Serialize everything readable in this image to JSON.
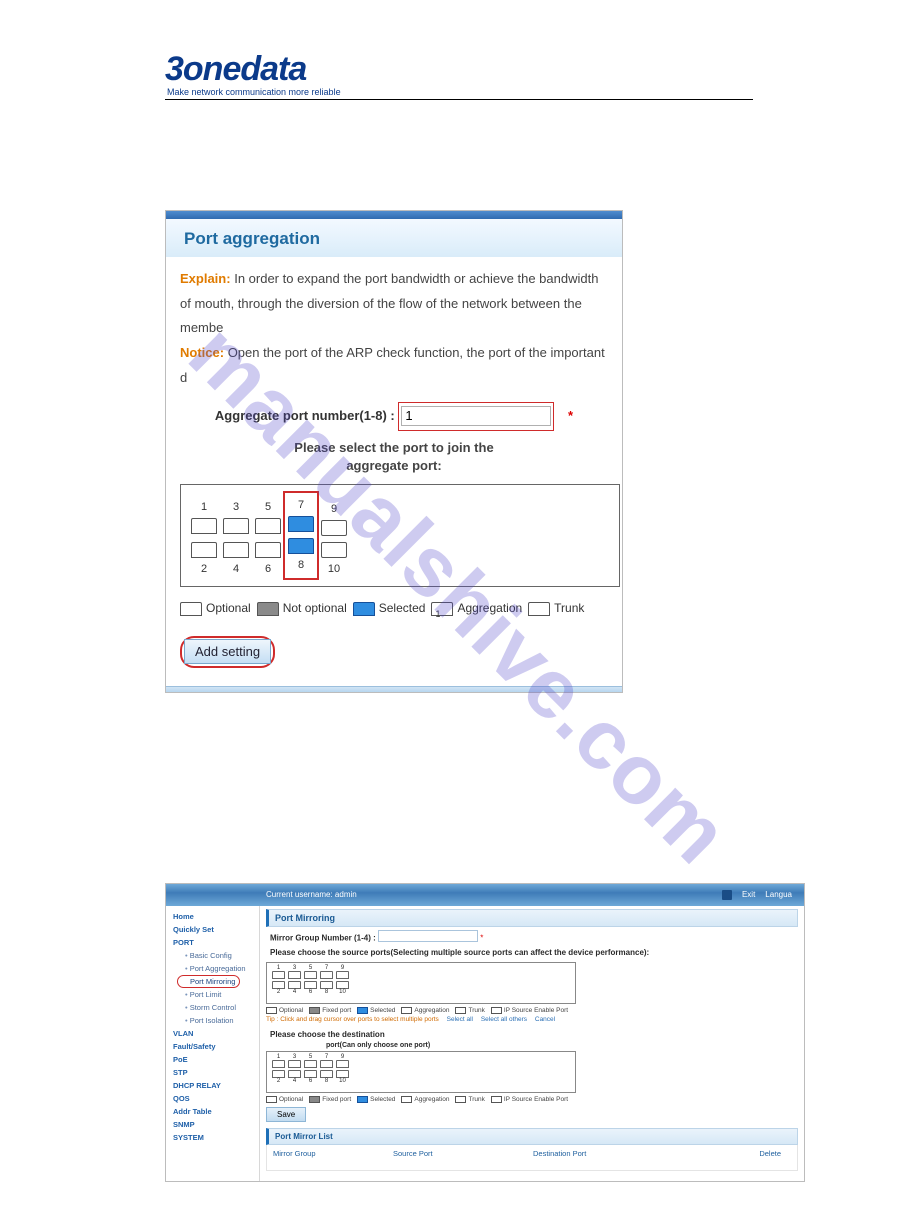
{
  "logo": {
    "brand": "3onedata",
    "tagline": "Make network communication more reliable"
  },
  "watermark": "manualshive.com",
  "shot1": {
    "title": "Port aggregation",
    "explain_label": "Explain:",
    "explain_text": "In order to expand the port bandwidth or achieve the bandwidth of mouth, through the diversion of the flow of the network between the membe",
    "notice_label": "Notice:",
    "notice_text": "Open the port of the ARP check function, the port of the important d",
    "agg_label": "Aggregate port number(1-8) :",
    "agg_value": "1",
    "asterisk": "*",
    "select_prompt_l1": "Please select the port to join the",
    "select_prompt_l2": "aggregate port:",
    "ports_top": [
      "1",
      "3",
      "5",
      "7",
      "9"
    ],
    "ports_bottom": [
      "2",
      "4",
      "6",
      "8",
      "10"
    ],
    "legend": {
      "optional": "Optional",
      "notoptional": "Not optional",
      "selected": "Selected",
      "aggregation": "Aggregation",
      "trunk": "Trunk"
    },
    "add_button": "Add setting"
  },
  "shot2": {
    "topbar": {
      "user": "Current username: admin",
      "exit": "Exit",
      "lang": "Langua"
    },
    "sidebar": {
      "items": [
        {
          "label": "Home",
          "type": "top"
        },
        {
          "label": "Quickly Set",
          "type": "top"
        },
        {
          "label": "PORT",
          "type": "section"
        },
        {
          "label": "Basic Config",
          "type": "sub"
        },
        {
          "label": "Port Aggregation",
          "type": "sub"
        },
        {
          "label": "Port Mirroring",
          "type": "sub",
          "selected": true
        },
        {
          "label": "Port Limit",
          "type": "sub"
        },
        {
          "label": "Storm Control",
          "type": "sub"
        },
        {
          "label": "Port Isolation",
          "type": "sub"
        },
        {
          "label": "VLAN",
          "type": "section"
        },
        {
          "label": "Fault/Safety",
          "type": "section"
        },
        {
          "label": "PoE",
          "type": "section"
        },
        {
          "label": "STP",
          "type": "section"
        },
        {
          "label": "DHCP RELAY",
          "type": "section"
        },
        {
          "label": "QOS",
          "type": "section"
        },
        {
          "label": "Addr Table",
          "type": "section"
        },
        {
          "label": "SNMP",
          "type": "section"
        },
        {
          "label": "SYSTEM",
          "type": "section"
        }
      ]
    },
    "main": {
      "heading": "Port Mirroring",
      "mirror_label": "Mirror Group Number (1-4) :",
      "mirror_asterisk": "*",
      "src_prompt": "Please choose the source ports(Selecting multiple source ports can affect the device performance):",
      "ports_top": [
        "1",
        "3",
        "5",
        "7",
        "9"
      ],
      "ports_bottom": [
        "2",
        "4",
        "6",
        "8",
        "10"
      ],
      "legend": {
        "optional": "Optional",
        "fixed": "Fixed port",
        "selected": "Selected",
        "aggregation": "Aggregation",
        "trunk": "Trunk",
        "ipsrc": "IP Source Enable Port"
      },
      "tip_prefix": "Tip :",
      "tip_text": "Click and drag cursor over ports to select multiple ports",
      "tip_links": {
        "all": "Select all",
        "others": "Select all others",
        "cancel": "Cancel"
      },
      "dst_prompt": "Please choose the destination",
      "dst_note": "port(Can only choose one port)",
      "save": "Save",
      "list_heading": "Port Mirror List",
      "cols": {
        "group": "Mirror Group",
        "src": "Source Port",
        "dst": "Destination Port",
        "del": "Delete"
      }
    }
  }
}
